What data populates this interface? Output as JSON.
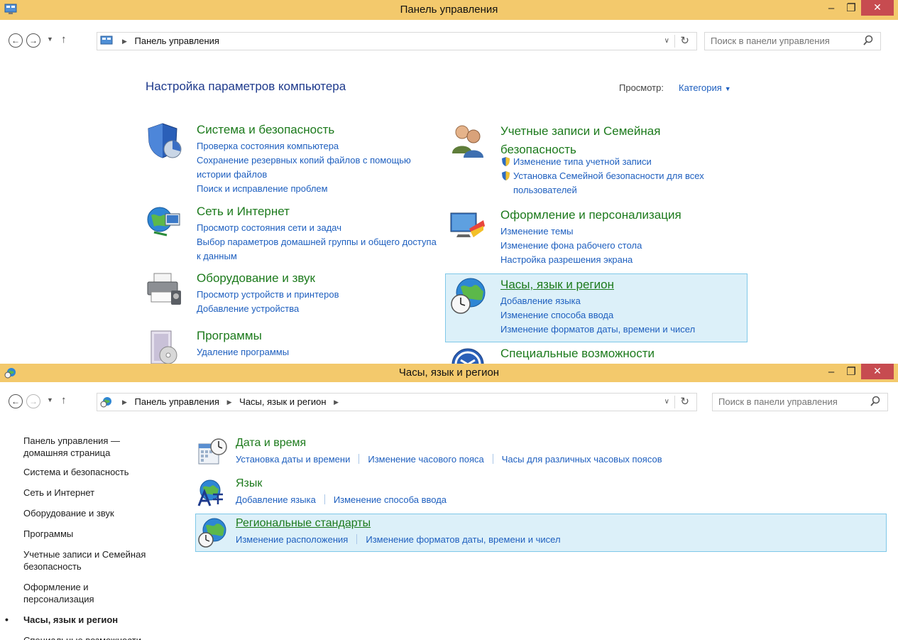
{
  "colors": {
    "titlebar": "#f3c96c",
    "close": "#c74b50",
    "link": "#1e5fbf",
    "category": "#1c7a1c",
    "highlight": "#dcf0f9"
  },
  "win1": {
    "title": "Панель управления",
    "breadcrumb": [
      "Панель управления"
    ],
    "search_placeholder": "Поиск в панели управления",
    "heading": "Настройка параметров компьютера",
    "view_label": "Просмотр:",
    "view_value": "Категория",
    "categories": [
      {
        "title": "Система и безопасность",
        "icon": "shield-icon",
        "links": [
          "Проверка состояния компьютера",
          "Сохранение резервных копий файлов с помощью истории файлов",
          "Поиск и исправление проблем"
        ]
      },
      {
        "title": "Сеть и Интернет",
        "icon": "network-globe-icon",
        "links": [
          "Просмотр состояния сети и задач",
          "Выбор параметров домашней группы и общего доступа к данным"
        ]
      },
      {
        "title": "Оборудование и звук",
        "icon": "printer-icon",
        "links": [
          "Просмотр устройств и принтеров",
          "Добавление устройства"
        ]
      },
      {
        "title": "Программы",
        "icon": "programs-icon",
        "links": [
          "Удаление программы"
        ]
      },
      {
        "title": "Учетные записи и Семейная безопасность",
        "icon": "users-icon",
        "links": [
          "Изменение типа учетной записи",
          "Установка Семейной безопасности для всех пользователей"
        ]
      },
      {
        "title": "Оформление и персонализация",
        "icon": "monitor-palette-icon",
        "links": [
          "Изменение темы",
          "Изменение фона рабочего стола",
          "Настройка разрешения экрана"
        ]
      },
      {
        "title": "Часы, язык и регион",
        "icon": "clock-globe-icon",
        "links": [
          "Добавление языка",
          "Изменение способа ввода",
          "Изменение форматов даты, времени и чисел"
        ]
      },
      {
        "title": "Специальные возможности",
        "icon": "accessibility-icon",
        "links": []
      }
    ]
  },
  "win2": {
    "title": "Часы, язык и регион",
    "breadcrumb": [
      "Панель управления",
      "Часы, язык и регион"
    ],
    "search_placeholder": "Поиск в панели управления",
    "sidebar": [
      "Панель управления — домашняя страница",
      "Система и безопасность",
      "Сеть и Интернет",
      "Оборудование и звук",
      "Программы",
      "Учетные записи и Семейная безопасность",
      "Оформление и персонализация",
      "Часы, язык и регион",
      "Специальные возможности"
    ],
    "tasks": [
      {
        "title": "Дата и время",
        "icon": "calendar-clock-icon",
        "links": [
          "Установка даты и времени",
          "Изменение часового пояса",
          "Часы для различных часовых поясов"
        ]
      },
      {
        "title": "Язык",
        "icon": "language-icon",
        "links": [
          "Добавление языка",
          "Изменение способа ввода"
        ]
      },
      {
        "title": "Региональные стандарты",
        "icon": "region-globe-icon",
        "links": [
          "Изменение расположения",
          "Изменение форматов даты, времени и чисел"
        ]
      }
    ]
  }
}
